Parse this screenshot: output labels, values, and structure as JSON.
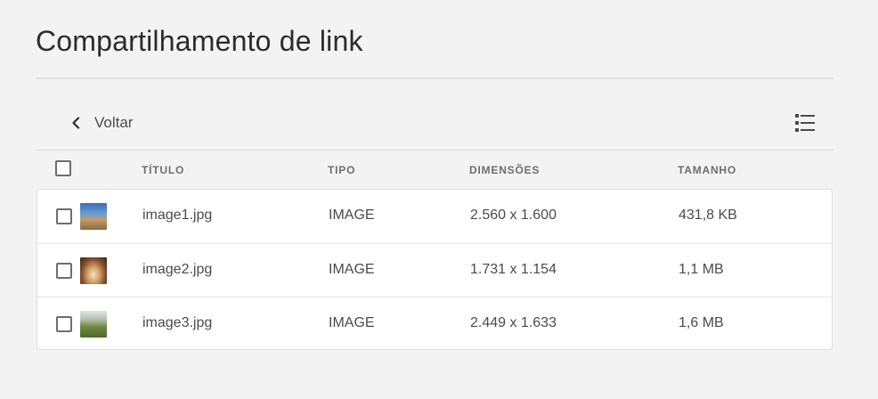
{
  "page": {
    "title": "Compartilhamento de link"
  },
  "toolbar": {
    "back_label": "Voltar",
    "back_icon": "chevron-left-icon",
    "view_icon": "list-view-icon"
  },
  "table": {
    "columns": {
      "title": "TÍTULO",
      "type": "TIPO",
      "dimensions": "DIMENSÕES",
      "size": "TAMANHO"
    },
    "rows": [
      {
        "title": "image1.jpg",
        "type": "IMAGE",
        "dimensions": "2.560 x 1.600",
        "size": "431,8 KB"
      },
      {
        "title": "image2.jpg",
        "type": "IMAGE",
        "dimensions": "1.731 x 1.154",
        "size": "1,1 MB"
      },
      {
        "title": "image3.jpg",
        "type": "IMAGE",
        "dimensions": "2.449 x 1.633",
        "size": "1,6 MB"
      }
    ]
  },
  "colors": {
    "background": "#f3f3f3",
    "surface": "#ffffff",
    "text": "#4b4b4b",
    "header_text": "#6e6e6e",
    "divider": "#e1e1e1"
  }
}
